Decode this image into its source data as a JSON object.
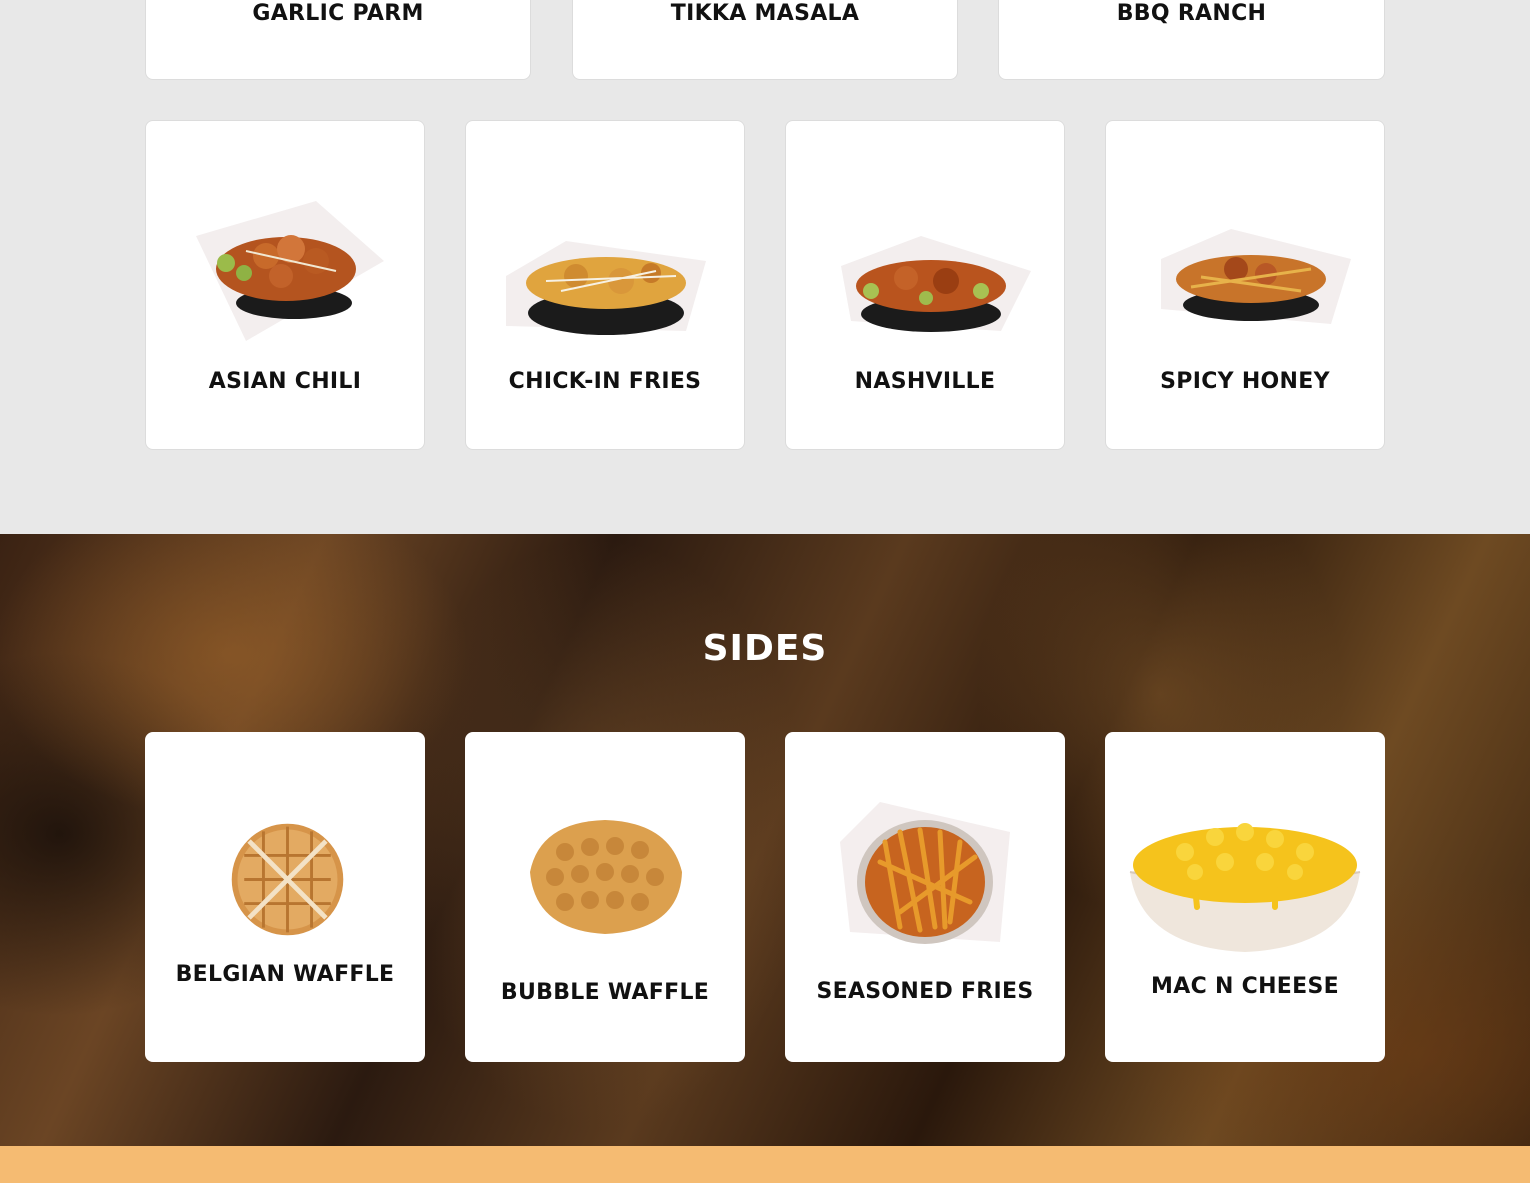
{
  "wings_top_row": [
    {
      "name": "GARLIC PARM"
    },
    {
      "name": "TIKKA MASALA"
    },
    {
      "name": "BBQ RANCH"
    }
  ],
  "wings_second_row": [
    {
      "name": "ASIAN CHILI"
    },
    {
      "name": "CHICK-IN FRIES"
    },
    {
      "name": "NASHVILLE"
    },
    {
      "name": "SPICY HONEY"
    }
  ],
  "sides": {
    "heading": "SIDES",
    "items": [
      {
        "name": "BELGIAN WAFFLE"
      },
      {
        "name": "BUBBLE WAFFLE"
      },
      {
        "name": "SEASONED FRIES"
      },
      {
        "name": "MAC N CHEESE"
      }
    ]
  },
  "colors": {
    "page_background": "#e8e8e8",
    "card_background": "#ffffff",
    "title_text": "#111111",
    "footer_band": "#f5bb72"
  }
}
